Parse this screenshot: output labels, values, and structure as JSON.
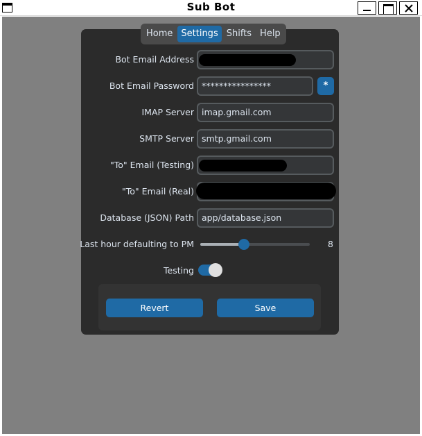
{
  "window": {
    "title": "Sub Bot"
  },
  "tabs": [
    {
      "label": "Home",
      "active": false
    },
    {
      "label": "Settings",
      "active": true
    },
    {
      "label": "Shifts",
      "active": false
    },
    {
      "label": "Help",
      "active": false
    }
  ],
  "form": {
    "bot_email": {
      "label": "Bot Email Address",
      "value": ""
    },
    "bot_password": {
      "label": "Bot Email Password",
      "value": "****************",
      "reveal_label": "*"
    },
    "imap": {
      "label": "IMAP Server",
      "value": "imap.gmail.com"
    },
    "smtp": {
      "label": "SMTP Server",
      "value": "smtp.gmail.com"
    },
    "to_testing": {
      "label": "\"To\" Email (Testing)",
      "value": ""
    },
    "to_real": {
      "label": "\"To\" Email (Real)",
      "value": ""
    },
    "db_path": {
      "label": "Database (JSON) Path",
      "value": "app/database.json"
    },
    "last_hour": {
      "label": "Last hour defaulting to PM",
      "value": "8",
      "fraction": 0.4
    },
    "testing": {
      "label": "Testing",
      "on": true
    }
  },
  "actions": {
    "revert_label": "Revert",
    "save_label": "Save"
  },
  "colors": {
    "accent": "#1f6aa5",
    "frame_bg": "#2b2b2b",
    "window_bg": "#808080",
    "entry_bg": "#343638",
    "text": "#dce4ee"
  }
}
